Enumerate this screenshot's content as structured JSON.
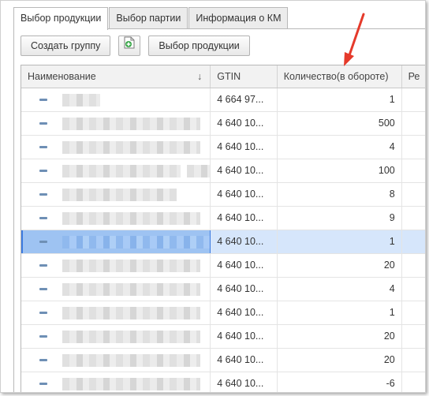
{
  "tabs": [
    {
      "label": "Выбор продукции",
      "active": true
    },
    {
      "label": "Выбор партии",
      "active": false
    },
    {
      "label": "Информация о КМ",
      "active": false
    }
  ],
  "toolbar": {
    "create_group": "Создать группу",
    "add_icon": "add-document-icon",
    "select_products": "Выбор продукции"
  },
  "grid": {
    "columns": [
      "Наименование",
      "GTIN",
      "Количество(в обороте)",
      "Ре"
    ],
    "sort_indicator": "↓",
    "rows": [
      {
        "gtin": "4 664 97...",
        "qty": "1"
      },
      {
        "gtin": "4 640 10...",
        "qty": "500"
      },
      {
        "gtin": "4 640 10...",
        "qty": "4"
      },
      {
        "gtin": "4 640 10...",
        "qty": "100"
      },
      {
        "gtin": "4 640 10...",
        "qty": "8"
      },
      {
        "gtin": "4 640 10...",
        "qty": "9"
      },
      {
        "gtin": "4 640 10...",
        "qty": "1",
        "selected": true
      },
      {
        "gtin": "4 640 10...",
        "qty": "20"
      },
      {
        "gtin": "4 640 10...",
        "qty": "4"
      },
      {
        "gtin": "4 640 10...",
        "qty": "1"
      },
      {
        "gtin": "4 640 10...",
        "qty": "20"
      },
      {
        "gtin": "4 640 10...",
        "qty": "20"
      },
      {
        "gtin": "4 640 10...",
        "qty": "-6"
      }
    ]
  },
  "annotation_color": "#e53a2b",
  "selection_color": "#d6e6fb"
}
